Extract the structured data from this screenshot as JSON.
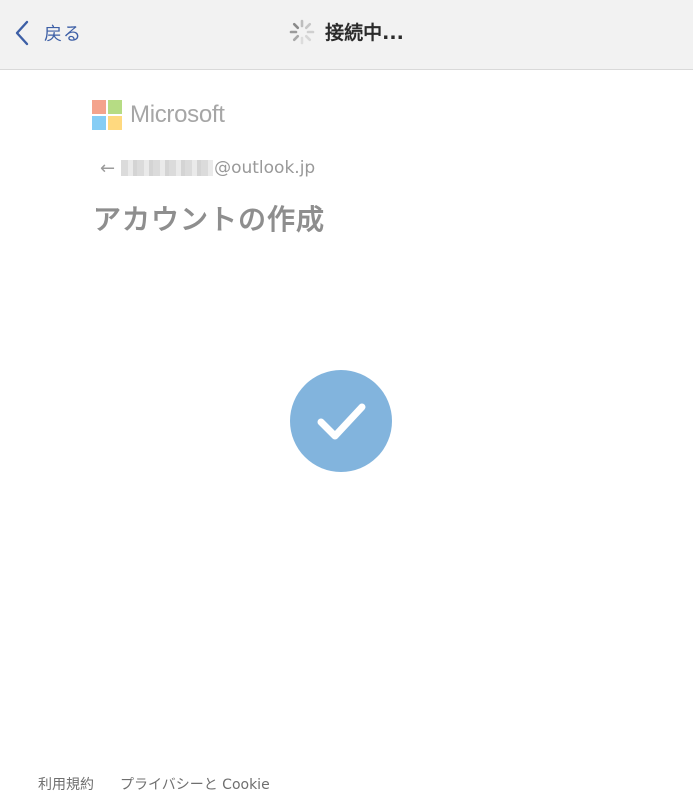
{
  "navbar": {
    "back_label": "戻る",
    "title": "接続中...",
    "back_icon": "chevron-left-icon",
    "spinner_icon": "loading-spinner-icon"
  },
  "brand": {
    "name": "Microsoft",
    "colors": [
      "#f25022",
      "#7fba00",
      "#00a4ef",
      "#ffb900"
    ]
  },
  "account": {
    "back_icon": "←",
    "email_domain": "@outlook.jp"
  },
  "heading": "アカウントの作成",
  "status": {
    "icon": "checkmark-icon",
    "color": "#82b4dd"
  },
  "footer": {
    "terms": "利用規約",
    "privacy": "プライバシーと Cookie"
  }
}
